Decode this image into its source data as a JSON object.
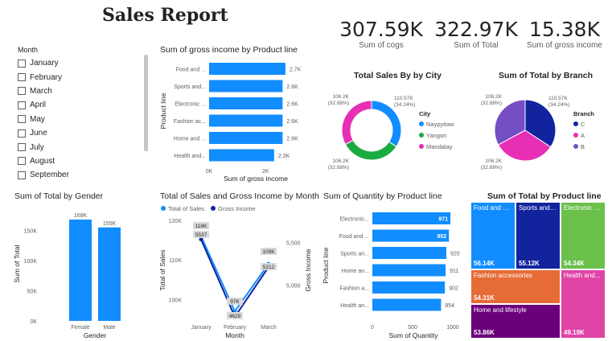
{
  "report": {
    "title": "Sales Report"
  },
  "kpis": [
    {
      "value": "307.59K",
      "label": "Sum of cogs"
    },
    {
      "value": "322.97K",
      "label": "Sum of Total"
    },
    {
      "value": "15.38K",
      "label": "Sum of gross income"
    }
  ],
  "slicer": {
    "header": "Month",
    "items": [
      "January",
      "February",
      "March",
      "April",
      "May",
      "June",
      "July",
      "August",
      "September"
    ]
  },
  "colors": {
    "blue": "#118dff",
    "navy": "#12239e",
    "green": "#6bc04b",
    "teal": "#1aab40",
    "pink": "#e62fb4",
    "purple": "#6b007b",
    "orange": "#e66c37",
    "magenta": "#e044a7",
    "slate": "#744ec2",
    "grey_axis": "#605e5c"
  },
  "chart_data": [
    {
      "id": "gross_income_by_product",
      "type": "bar",
      "orientation": "horizontal",
      "title": "Sum of gross income by Product line",
      "xlabel": "Sum of gross income",
      "ylabel": "Product line",
      "categories": [
        "Food and ...",
        "Sports and...",
        "Electronic ...",
        "Fashion ac...",
        "Home and ...",
        "Health and..."
      ],
      "values": [
        2.7,
        2.6,
        2.6,
        2.6,
        2.6,
        2.3
      ],
      "data_labels": [
        "2.7K",
        "2.6K",
        "2.6K",
        "2.6K",
        "2.6K",
        "2.3K"
      ],
      "x_ticks": [
        "0K",
        "2K"
      ],
      "xlim": [
        0,
        3.3
      ]
    },
    {
      "id": "sales_by_city",
      "type": "pie",
      "donut": true,
      "title": "Total Sales By by City",
      "legend_title": "City",
      "legend_position": "right",
      "categories": [
        "Naypyitaw",
        "Yangon",
        "Mandalay"
      ],
      "values": [
        110.57,
        106.2,
        106.2
      ],
      "data_labels": [
        "110.57K (34.24%)",
        "106.2K (32.88%)",
        "106.2K (32.88%)"
      ],
      "colors": [
        "#118dff",
        "#1aab40",
        "#e62fb4"
      ]
    },
    {
      "id": "total_by_branch",
      "type": "pie",
      "title": "Sum of Total by Branch",
      "legend_title": "Branch",
      "legend_position": "right",
      "categories": [
        "C",
        "A",
        "B"
      ],
      "values": [
        110.57,
        106.2,
        106.2
      ],
      "data_labels": [
        "110.57K (34.24%)",
        "106.2K (32.88%)",
        "106.2K (32.88%)"
      ],
      "colors": [
        "#12239e",
        "#e62fb4",
        "#744ec2"
      ]
    },
    {
      "id": "total_by_gender",
      "type": "bar",
      "title": "Sum of Total by Gender",
      "xlabel": "Gender",
      "ylabel": "Sum of Total",
      "categories": [
        "Female",
        "Male"
      ],
      "values": [
        168,
        155
      ],
      "data_labels": [
        "168K",
        "155K"
      ],
      "y_ticks": [
        "0K",
        "50K",
        "100K",
        "150K"
      ],
      "ylim": [
        0,
        180
      ]
    },
    {
      "id": "sales_gross_by_month",
      "type": "line",
      "title": "Total of Sales and Gross Income by Month",
      "xlabel": "Month",
      "ylabel": "Total of Sales",
      "y2label": "Gross Income",
      "categories": [
        "January",
        "February",
        "March"
      ],
      "series": [
        {
          "name": "Total of Sales",
          "axis": "left",
          "values": [
            116,
            97,
            109
          ],
          "data_labels": [
            "116K",
            "97K",
            "109K"
          ],
          "color": "#118dff"
        },
        {
          "name": "Gross Income",
          "axis": "right",
          "values": [
            5537,
            4629,
            5212
          ],
          "data_labels": [
            "5537",
            "4629",
            "5212"
          ],
          "color": "#12239e"
        }
      ],
      "y_ticks": [
        "100K",
        "110K",
        "120K"
      ],
      "ylim": [
        95,
        120
      ],
      "y2_ticks": [
        "5,000",
        "5,500"
      ],
      "y2lim": [
        4600,
        5760
      ]
    },
    {
      "id": "quantity_by_product",
      "type": "bar",
      "orientation": "horizontal",
      "title": "Sum of Quantity by Product line",
      "xlabel": "Sum of Quantity",
      "ylabel": "Product line",
      "categories": [
        "Electronic...",
        "Food and ...",
        "Sports an...",
        "Home an...",
        "Fashion a...",
        "Health an..."
      ],
      "values": [
        971,
        952,
        920,
        911,
        902,
        854
      ],
      "data_labels": [
        "971",
        "952",
        "920",
        "911",
        "902",
        "854"
      ],
      "x_ticks": [
        "0",
        "500",
        "1000"
      ],
      "xlim": [
        0,
        1000
      ]
    },
    {
      "id": "total_by_product_treemap",
      "type": "treemap",
      "title": "Sum of Total by Product line",
      "categories": [
        "Food and be...",
        "Sports and t...",
        "Electronic a...",
        "Fashion accessories",
        "Health and...",
        "Home and lifestyle"
      ],
      "values": [
        56.14,
        55.12,
        54.34,
        54.31,
        49.19,
        53.86
      ],
      "data_labels": [
        "56.14K",
        "55.12K",
        "54.34K",
        "54.31K",
        "49.19K",
        "53.86K"
      ]
    }
  ]
}
